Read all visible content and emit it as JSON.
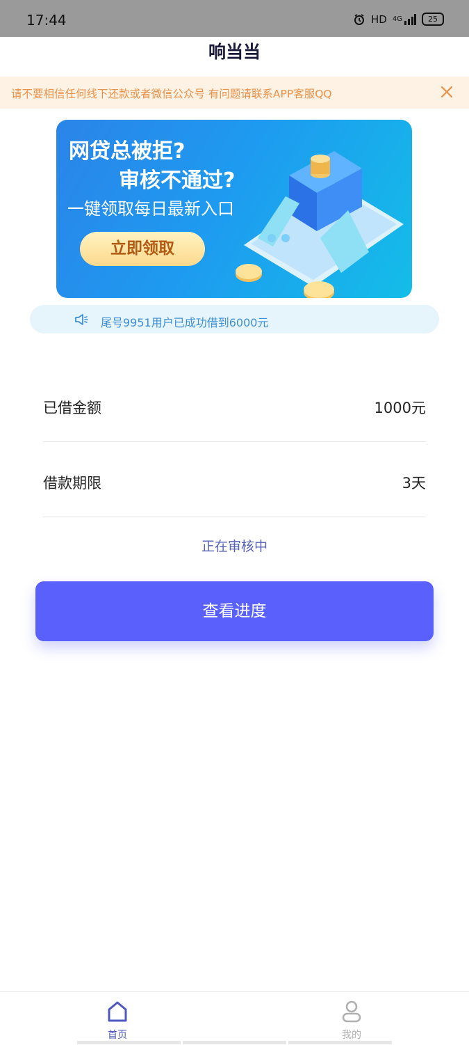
{
  "status_bar": {
    "time": "17:44",
    "hd": "HD",
    "network": "4G",
    "battery": "25"
  },
  "header": {
    "title": "响当当"
  },
  "notice": {
    "text": "请不要相信任何线下还款或者微信公众号  有问题请联系APP客服QQ",
    "close_icon": "close-icon"
  },
  "banner": {
    "line1": "网贷总被拒?",
    "line2": "审核不通过?",
    "line3": "一键领取每日最新入口",
    "button": "立即领取"
  },
  "ticker": {
    "icon": "speaker-icon",
    "text": "尾号9951用户已成功借到6000元"
  },
  "loan": {
    "amount_label": "已借金额",
    "amount_value": "1000元",
    "term_label": "借款期限",
    "term_value": "3天",
    "status": "正在审核中",
    "progress_button": "查看进度"
  },
  "tabbar": {
    "items": [
      {
        "label": "首页",
        "icon": "home-icon",
        "active": true
      },
      {
        "label": "我的",
        "icon": "user-icon",
        "active": false
      }
    ]
  },
  "colors": {
    "accent": "#5a60fb",
    "notice_text": "#e8924b",
    "notice_bg": "#fdf2e3",
    "ticker_text": "#3f8fd6",
    "status_text": "#5660b6"
  }
}
